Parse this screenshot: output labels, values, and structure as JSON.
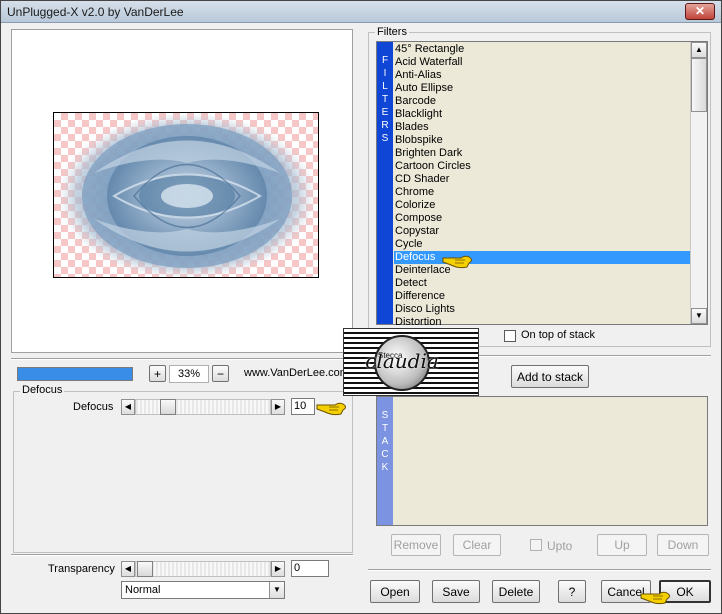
{
  "window": {
    "title": "UnPlugged-X v2.0 by VanDerLee",
    "close_glyph": "✕"
  },
  "preview": {
    "zoom_minus": "−",
    "zoom_plus": "+",
    "zoom_value": "33%",
    "website": "www.VanDerLee.com",
    "progress": 1.0
  },
  "params": {
    "group_title": "Defocus",
    "defocus_label": "Defocus",
    "defocus_value": "10",
    "transparency_label": "Transparency",
    "transparency_value": "0",
    "blend_mode": "Normal"
  },
  "filters": {
    "group_title": "Filters",
    "side_label": [
      "F",
      "I",
      "L",
      "T",
      "E",
      "R",
      "S"
    ],
    "selected": "Defocus",
    "items": [
      "45° Rectangle",
      "Acid Waterfall",
      "Anti-Alias",
      "Auto Ellipse",
      "Barcode",
      "Blacklight",
      "Blades",
      "Blobspike",
      "Brighten Dark",
      "Cartoon Circles",
      "CD Shader",
      "Chrome",
      "Colorize",
      "Compose",
      "Copystar",
      "Cycle",
      "Defocus",
      "Deinterlace",
      "Detect",
      "Difference",
      "Disco Lights",
      "Distortion"
    ],
    "on_top_label": "On top of stack",
    "add_to_stack": "Add to stack"
  },
  "stack": {
    "side_label": [
      "S",
      "T",
      "A",
      "C",
      "K"
    ],
    "remove": "Remove",
    "clear": "Clear",
    "upto": "Upto",
    "up": "Up",
    "down": "Down"
  },
  "footer": {
    "open": "Open",
    "save": "Save",
    "delete": "Delete",
    "help": "?",
    "cancel": "Cancel",
    "ok": "OK"
  },
  "watermark": {
    "text": "claudia",
    "small": "Stecca"
  },
  "colors": {
    "filters_bar": "#1046d6",
    "stack_bar": "#7b93e0",
    "selection": "#3399ff",
    "list_bg": "#ece9d8",
    "pointer": "#f5d000"
  }
}
